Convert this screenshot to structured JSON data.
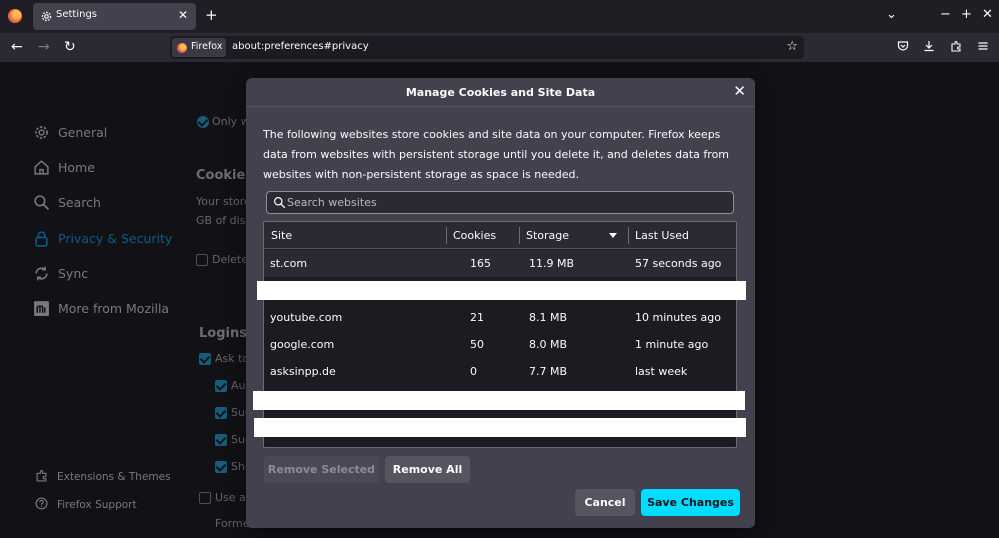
{
  "browser": {
    "tab_title": "Settings",
    "tab_close": "✕",
    "new_tab": "+",
    "url_identity": "Firefox",
    "url": "about:preferences#privacy",
    "window_controls": [
      "⌄",
      "−",
      "+",
      "✕"
    ]
  },
  "sidebar": {
    "items": [
      {
        "label": "General",
        "icon": "gear-icon"
      },
      {
        "label": "Home",
        "icon": "home-icon"
      },
      {
        "label": "Search",
        "icon": "search-icon"
      },
      {
        "label": "Privacy & Security",
        "icon": "lock-icon",
        "active": true
      },
      {
        "label": "Sync",
        "icon": "sync-icon"
      },
      {
        "label": "More from Mozilla",
        "icon": "mozilla-icon"
      }
    ],
    "footer": [
      {
        "label": "Extensions & Themes",
        "icon": "puzzle-icon"
      },
      {
        "label": "Firefox Support",
        "icon": "help-icon"
      }
    ]
  },
  "background": {
    "only_fragment": "Only w",
    "cookies_heading": "Cookies",
    "cookies_line1": "Your store",
    "cookies_line2": "GB of disk",
    "delete_label": "Delete",
    "logins_heading": "Logins a",
    "ask_label": "Ask to",
    "auto_label": "Au",
    "sug1_label": "Sug",
    "sug2_label": "Sug",
    "show_label": "Sho",
    "use_label": "Use a",
    "formerly_label": "Forme"
  },
  "modal": {
    "title": "Manage Cookies and Site Data",
    "close": "✕",
    "description": "The following websites store cookies and site data on your computer. Firefox keeps data from websites with persistent storage until you delete it, and deletes data from websites with non-persistent storage as space is needed.",
    "search_placeholder": "Search websites",
    "columns": {
      "site": "Site",
      "cookies": "Cookies",
      "storage": "Storage",
      "last_used": "Last Used"
    },
    "rows": [
      {
        "site": "st.com",
        "cookies": "165",
        "storage": "11.9 MB",
        "last_used": "57 seconds ago"
      },
      {
        "site": "youtube.com",
        "cookies": "21",
        "storage": "8.1 MB",
        "last_used": "10 minutes ago"
      },
      {
        "site": "google.com",
        "cookies": "50",
        "storage": "8.0 MB",
        "last_used": "1 minute ago"
      },
      {
        "site": "asksinpp.de",
        "cookies": "0",
        "storage": "7.7 MB",
        "last_used": "last week"
      }
    ],
    "remove_selected": "Remove Selected",
    "remove_all": "Remove All",
    "cancel": "Cancel",
    "save": "Save Changes"
  },
  "colors": {
    "accent": "#00ddff",
    "active_sidebar": "#0d8fd6",
    "dialog_bg": "#42414d",
    "page_bg": "#1c1b22"
  }
}
